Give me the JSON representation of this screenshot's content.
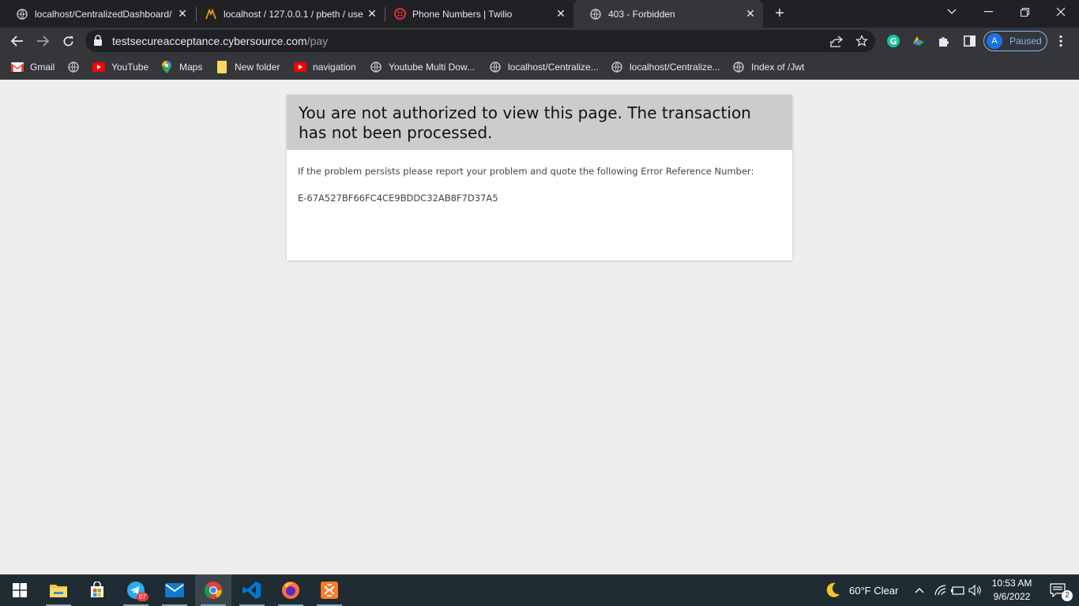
{
  "browser": {
    "tabs": [
      {
        "title": "localhost/CentralizedDashboard/",
        "icon": "globe-icon",
        "active": false
      },
      {
        "title": "localhost / 127.0.0.1 / pbeth / use",
        "icon": "phpmyadmin-icon",
        "active": false
      },
      {
        "title": "Phone Numbers | Twilio",
        "icon": "twilio-icon",
        "active": false
      },
      {
        "title": "403 - Forbidden",
        "icon": "globe-icon",
        "active": true
      }
    ],
    "url_host": "testsecureacceptance.cybersource.com",
    "url_path": "/pay",
    "profile_initial": "A",
    "profile_status": "Paused",
    "bookmarks": [
      {
        "label": "Gmail",
        "icon": "gmail-icon"
      },
      {
        "label": "",
        "icon": "globe-icon"
      },
      {
        "label": "YouTube",
        "icon": "youtube-icon"
      },
      {
        "label": "Maps",
        "icon": "maps-icon"
      },
      {
        "label": "New folder",
        "icon": "folder-icon"
      },
      {
        "label": "navigation",
        "icon": "youtube-icon"
      },
      {
        "label": "Youtube Multi Dow...",
        "icon": "globe-icon"
      },
      {
        "label": "localhost/Centralize...",
        "icon": "globe-icon"
      },
      {
        "label": "localhost/Centralize...",
        "icon": "globe-icon"
      },
      {
        "label": "Index of /Jwt",
        "icon": "globe-icon"
      }
    ]
  },
  "page": {
    "heading": "You are not authorized to view this page. The transaction has not been processed.",
    "message": "If the problem persists please report your problem and quote the following Error Reference Number:",
    "error_reference": "E-67A527BF66FC4CE9BDDC32AB8F7D37A5"
  },
  "taskbar": {
    "telegram_badge": "07",
    "weather": "60°F  Clear",
    "time": "10:53 AM",
    "date": "9/6/2022",
    "notification_count": "2"
  },
  "colors": {
    "accent": "#8ab4f8",
    "card_header": "#cccccc",
    "page_bg": "#eeeeee"
  }
}
